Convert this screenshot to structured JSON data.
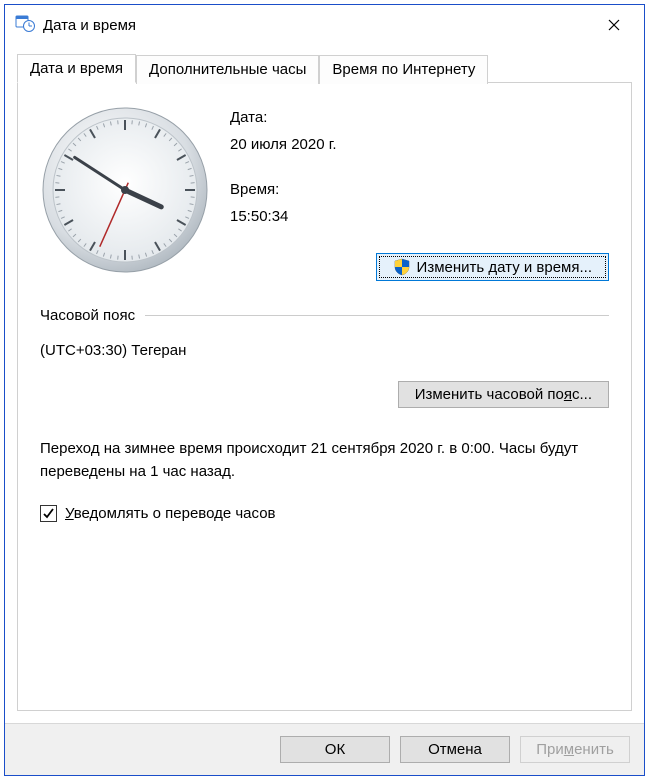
{
  "window": {
    "title": "Дата и время"
  },
  "tabs": {
    "datetime": "Дата и время",
    "additional": "Дополнительные часы",
    "internet": "Время по Интернету"
  },
  "datetime": {
    "date_label": "Дата:",
    "date_value": "20 июля 2020 г.",
    "time_label": "Время:",
    "time_value": "15:50:34",
    "change_prefix": "Изменить ",
    "change_accel": "д",
    "change_suffix": "ату и время..."
  },
  "timezone": {
    "label": "Часовой пояс",
    "value": "(UTC+03:30) Тегеран",
    "change_prefix": "Изменить часовой по",
    "change_accel": "я",
    "change_suffix": "с..."
  },
  "dst": {
    "text": "Переход на зимнее время происходит 21 сентября 2020 г. в 0:00. Часы будут переведены на 1 час назад.",
    "notify_prefix": "",
    "notify_accel": "У",
    "notify_suffix": "ведомлять о переводе часов",
    "notify_checked": true
  },
  "footer": {
    "ok": "ОК",
    "cancel": "Отмена",
    "apply_prefix": "При",
    "apply_accel": "м",
    "apply_suffix": "енить"
  },
  "clock": {
    "hour_angle": 115,
    "minute_angle": 303,
    "second_angle": 204
  }
}
